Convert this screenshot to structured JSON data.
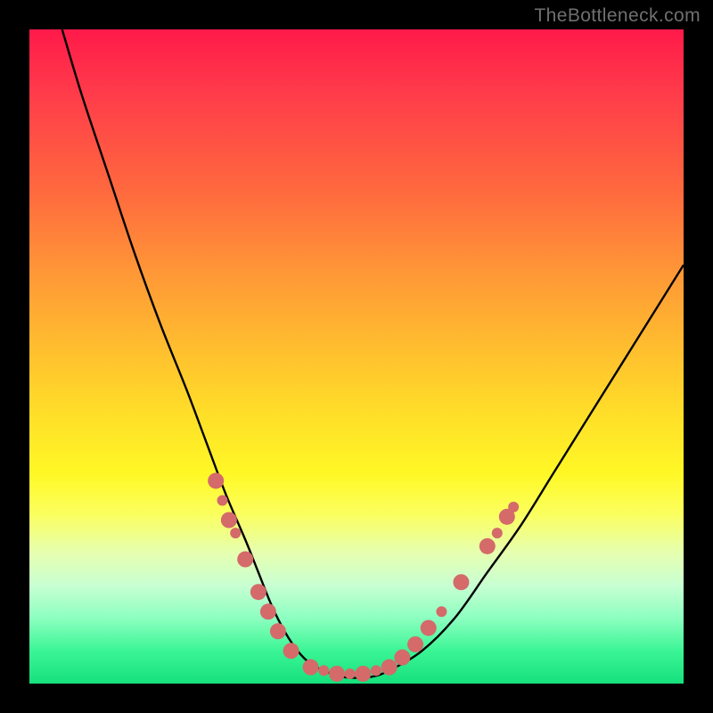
{
  "watermark": "TheBottleneck.com",
  "chart_data": {
    "type": "line",
    "title": "",
    "xlabel": "",
    "ylabel": "",
    "xlim": [
      0,
      100
    ],
    "ylim": [
      0,
      100
    ],
    "grid": false,
    "legend": false,
    "series": [
      {
        "name": "bottleneck-curve",
        "color": "#000000",
        "x": [
          5,
          8,
          12,
          16,
          20,
          24,
          27,
          30,
          33,
          35,
          37,
          39,
          41,
          43,
          45,
          48,
          52,
          55,
          60,
          65,
          70,
          75,
          80,
          85,
          90,
          95,
          100
        ],
        "y": [
          100,
          90,
          78,
          66,
          55,
          45,
          37,
          29,
          22,
          17,
          12,
          8,
          5,
          3,
          2,
          1,
          1,
          2,
          5,
          10,
          17,
          24,
          32,
          40,
          48,
          56,
          64
        ]
      }
    ],
    "markers": {
      "name": "highlighted-points",
      "color": "#d46a6a",
      "radius_main": 9,
      "radius_secondary": 6,
      "points": [
        {
          "x": 28.5,
          "y": 31,
          "r": "main"
        },
        {
          "x": 29.5,
          "y": 28,
          "r": "secondary"
        },
        {
          "x": 30.5,
          "y": 25,
          "r": "main"
        },
        {
          "x": 31.5,
          "y": 23,
          "r": "secondary"
        },
        {
          "x": 33,
          "y": 19,
          "r": "main"
        },
        {
          "x": 35,
          "y": 14,
          "r": "main"
        },
        {
          "x": 36.5,
          "y": 11,
          "r": "main"
        },
        {
          "x": 38,
          "y": 8,
          "r": "main"
        },
        {
          "x": 40,
          "y": 5,
          "r": "main"
        },
        {
          "x": 43,
          "y": 2.5,
          "r": "main"
        },
        {
          "x": 45,
          "y": 2,
          "r": "secondary"
        },
        {
          "x": 47,
          "y": 1.5,
          "r": "main"
        },
        {
          "x": 49,
          "y": 1.5,
          "r": "secondary"
        },
        {
          "x": 51,
          "y": 1.5,
          "r": "main"
        },
        {
          "x": 53,
          "y": 2,
          "r": "secondary"
        },
        {
          "x": 55,
          "y": 2.5,
          "r": "main"
        },
        {
          "x": 57,
          "y": 4,
          "r": "main"
        },
        {
          "x": 59,
          "y": 6,
          "r": "main"
        },
        {
          "x": 61,
          "y": 8.5,
          "r": "main"
        },
        {
          "x": 63,
          "y": 11,
          "r": "secondary"
        },
        {
          "x": 66,
          "y": 15.5,
          "r": "main"
        },
        {
          "x": 70,
          "y": 21,
          "r": "main"
        },
        {
          "x": 71.5,
          "y": 23,
          "r": "secondary"
        },
        {
          "x": 73,
          "y": 25.5,
          "r": "main"
        },
        {
          "x": 74,
          "y": 27,
          "r": "secondary"
        }
      ]
    }
  }
}
